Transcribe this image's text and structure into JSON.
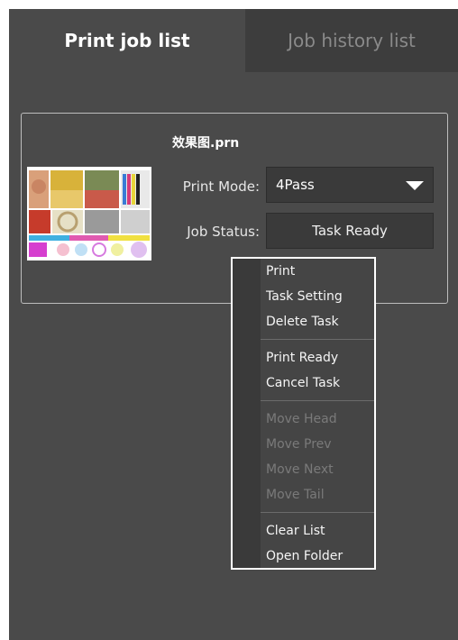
{
  "tabs": [
    {
      "label": "Print job list"
    },
    {
      "label": "Job history list"
    }
  ],
  "job": {
    "filename": "效果图.prn",
    "print_mode_label": "Print Mode:",
    "print_mode_value": "4Pass",
    "job_status_label": "Job Status:",
    "job_status_value": "Task Ready"
  },
  "context_menu": {
    "items": [
      {
        "label": "Print",
        "enabled": true
      },
      {
        "label": "Task Setting",
        "enabled": true
      },
      {
        "label": "Delete Task",
        "enabled": true
      },
      {
        "label": "Print Ready",
        "enabled": true
      },
      {
        "label": "Cancel Task",
        "enabled": true
      },
      {
        "label": "Move Head",
        "enabled": false
      },
      {
        "label": "Move Prev",
        "enabled": false
      },
      {
        "label": "Move Next",
        "enabled": false
      },
      {
        "label": "Move Tail",
        "enabled": false
      },
      {
        "label": "Clear List",
        "enabled": true
      },
      {
        "label": "Open Folder",
        "enabled": true
      }
    ]
  },
  "colors": {
    "panel_bg": "#4a4a4a",
    "inactive_tab_bg": "#3d3d3d",
    "field_bg": "#3a3a3a",
    "menu_bg": "#454545",
    "text_primary": "#ffffff",
    "text_disabled": "#7a7a7a"
  },
  "icons": {
    "dropdown": "chevron-down-icon",
    "thumbnail": "print-preview-thumbnail"
  }
}
